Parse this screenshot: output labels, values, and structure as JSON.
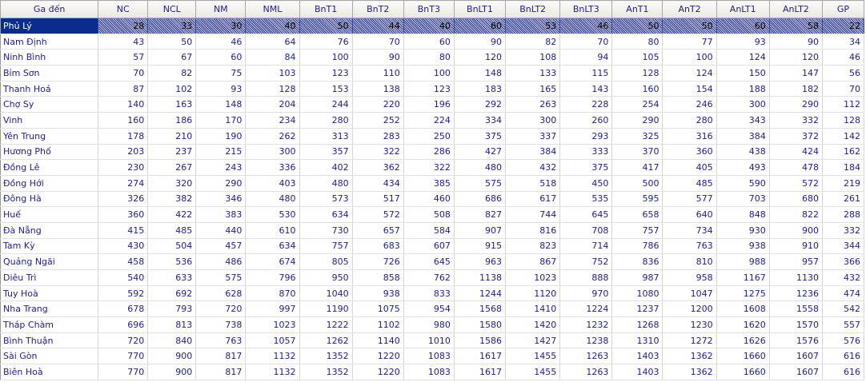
{
  "headers": [
    "Ga đến",
    "NC",
    "NCL",
    "NM",
    "NML",
    "BnT1",
    "BnT2",
    "BnT3",
    "BnLT1",
    "BnLT2",
    "BnLT3",
    "AnT1",
    "AnT2",
    "AnLT1",
    "AnLT2",
    "GP"
  ],
  "selected_row": 0,
  "rows": [
    {
      "station": "Phủ Lý",
      "values": [
        28,
        33,
        30,
        40,
        50,
        44,
        40,
        60,
        53,
        46,
        50,
        50,
        60,
        58,
        22
      ]
    },
    {
      "station": "Nam Định",
      "values": [
        43,
        50,
        46,
        64,
        76,
        70,
        60,
        90,
        82,
        70,
        80,
        77,
        93,
        90,
        34
      ]
    },
    {
      "station": "Ninh Bình",
      "values": [
        57,
        67,
        60,
        84,
        100,
        90,
        80,
        120,
        108,
        94,
        105,
        100,
        124,
        120,
        46
      ]
    },
    {
      "station": "Bỉm Sơn",
      "values": [
        70,
        82,
        75,
        103,
        123,
        110,
        100,
        148,
        133,
        115,
        128,
        124,
        150,
        147,
        56
      ]
    },
    {
      "station": "Thanh Hoá",
      "values": [
        87,
        102,
        93,
        128,
        153,
        138,
        123,
        183,
        165,
        143,
        160,
        154,
        188,
        182,
        70
      ]
    },
    {
      "station": "Chợ Sy",
      "values": [
        140,
        163,
        148,
        204,
        244,
        220,
        196,
        292,
        263,
        228,
        254,
        246,
        300,
        290,
        112
      ]
    },
    {
      "station": "Vinh",
      "values": [
        160,
        186,
        170,
        234,
        280,
        252,
        224,
        334,
        300,
        260,
        290,
        280,
        343,
        332,
        128
      ]
    },
    {
      "station": "Yên Trung",
      "values": [
        178,
        210,
        190,
        262,
        313,
        283,
        250,
        375,
        337,
        293,
        325,
        316,
        384,
        372,
        142
      ]
    },
    {
      "station": "Hương Phố",
      "values": [
        203,
        237,
        215,
        300,
        357,
        322,
        286,
        427,
        384,
        333,
        370,
        360,
        438,
        424,
        162
      ]
    },
    {
      "station": "Đồng Lê",
      "values": [
        230,
        267,
        243,
        336,
        402,
        362,
        322,
        480,
        432,
        375,
        417,
        405,
        493,
        478,
        184
      ]
    },
    {
      "station": "Đồng Hới",
      "values": [
        274,
        320,
        290,
        403,
        480,
        434,
        385,
        575,
        518,
        450,
        500,
        485,
        590,
        572,
        219
      ]
    },
    {
      "station": "Đông Hà",
      "values": [
        326,
        382,
        346,
        480,
        573,
        517,
        460,
        686,
        617,
        535,
        595,
        577,
        703,
        680,
        261
      ]
    },
    {
      "station": "Huế",
      "values": [
        360,
        422,
        383,
        530,
        634,
        572,
        508,
        827,
        744,
        645,
        658,
        640,
        848,
        822,
        288
      ]
    },
    {
      "station": "Đà Nẵng",
      "values": [
        415,
        485,
        440,
        610,
        730,
        657,
        584,
        907,
        816,
        708,
        757,
        734,
        930,
        900,
        332
      ]
    },
    {
      "station": "Tam Kỳ",
      "values": [
        430,
        504,
        457,
        634,
        757,
        683,
        607,
        915,
        823,
        714,
        786,
        763,
        938,
        910,
        344
      ]
    },
    {
      "station": "Quảng Ngãi",
      "values": [
        458,
        536,
        486,
        674,
        805,
        726,
        645,
        963,
        867,
        752,
        836,
        810,
        988,
        957,
        366
      ]
    },
    {
      "station": "Diêu Trì",
      "values": [
        540,
        633,
        575,
        796,
        950,
        858,
        762,
        1138,
        1023,
        888,
        987,
        958,
        1167,
        1130,
        432
      ]
    },
    {
      "station": "Tuy Hoà",
      "values": [
        592,
        692,
        628,
        870,
        1040,
        938,
        833,
        1244,
        1120,
        970,
        1080,
        1047,
        1275,
        1236,
        474
      ]
    },
    {
      "station": "Nha Trang",
      "values": [
        678,
        793,
        720,
        997,
        1190,
        1075,
        954,
        1568,
        1410,
        1224,
        1237,
        1200,
        1608,
        1558,
        542
      ]
    },
    {
      "station": "Tháp Chàm",
      "values": [
        696,
        813,
        738,
        1023,
        1222,
        1102,
        980,
        1580,
        1420,
        1232,
        1268,
        1230,
        1620,
        1570,
        557
      ]
    },
    {
      "station": "Bình Thuận",
      "values": [
        720,
        840,
        763,
        1057,
        1262,
        1140,
        1010,
        1586,
        1427,
        1238,
        1310,
        1272,
        1626,
        1576,
        576
      ]
    },
    {
      "station": "Sài Gòn",
      "values": [
        770,
        900,
        817,
        1132,
        1352,
        1220,
        1083,
        1617,
        1455,
        1263,
        1403,
        1362,
        1660,
        1607,
        616
      ]
    },
    {
      "station": "Biên Hoà",
      "values": [
        770,
        900,
        817,
        1132,
        1352,
        1220,
        1083,
        1617,
        1455,
        1263,
        1403,
        1362,
        1660,
        1607,
        616
      ]
    }
  ]
}
